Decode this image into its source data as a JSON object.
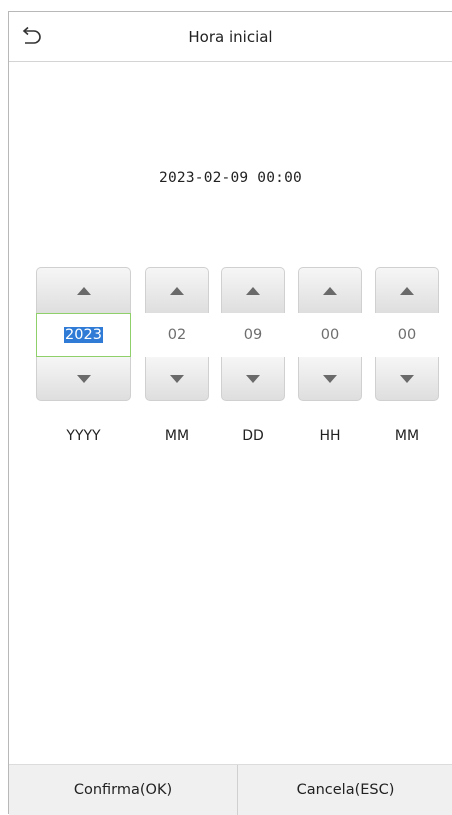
{
  "header": {
    "title": "Hora inicial",
    "back_icon": "back-arrow-icon"
  },
  "datetime_display": "2023-02-09 00:00",
  "spinners": [
    {
      "value": "2023",
      "unit": "YYYY",
      "selected": true
    },
    {
      "value": "02",
      "unit": "MM",
      "selected": false
    },
    {
      "value": "09",
      "unit": "DD",
      "selected": false
    },
    {
      "value": "00",
      "unit": "HH",
      "selected": false
    },
    {
      "value": "00",
      "unit": "MM",
      "selected": false
    }
  ],
  "footer": {
    "confirm_label": "Confirma(OK)",
    "cancel_label": "Cancela(ESC)"
  },
  "colors": {
    "selection": "#2f7bd6",
    "focus_border": "#8fd06a"
  }
}
